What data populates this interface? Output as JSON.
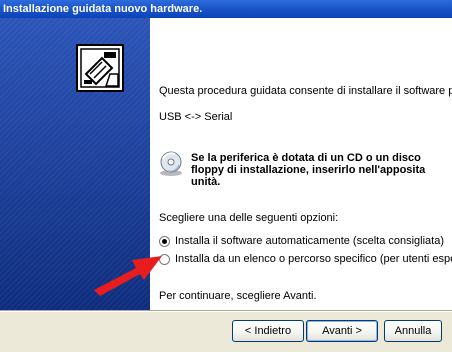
{
  "window": {
    "title": "Installazione guidata nuovo hardware."
  },
  "main": {
    "intro": "Questa procedura guidata consente di installare il software per:",
    "device_name": "USB <-> Serial",
    "cd_instructions": "Se la periferica è dotata di un CD o un disco floppy di installazione, inserirlo nell'apposita unità.",
    "options_label": "Scegliere una delle seguenti opzioni:",
    "options": [
      {
        "label": "Installa il software automaticamente (scelta consigliata)",
        "selected": true
      },
      {
        "label": "Installa da un elenco o percorso specifico (per utenti esperti)",
        "selected": false
      }
    ],
    "footer_text": "Per continuare, scegliere Avanti."
  },
  "buttons": {
    "back": "< Indietro",
    "next": "Avanti >",
    "cancel": "Annulla"
  },
  "icons": {
    "side_panel": "hardware-card-icon",
    "cd": "cd-disc-icon",
    "annotation": "red-arrow-icon"
  },
  "colors": {
    "title_bar": "#0a43b8",
    "side_panel": "#1a3e97",
    "annotation_arrow": "#e81e1e"
  }
}
